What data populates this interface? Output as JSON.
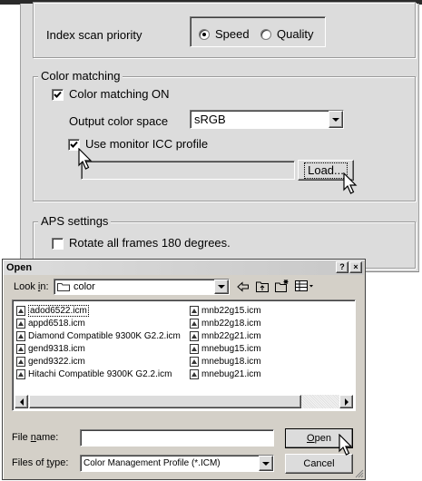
{
  "settings": {
    "index_scan": {
      "label": "Index scan priority",
      "options": [
        {
          "label": "Speed",
          "selected": true
        },
        {
          "label": "Quality",
          "selected": false
        }
      ]
    },
    "color_matching": {
      "title": "Color matching",
      "enable_label": "Color matching ON",
      "enable_checked": true,
      "output_space_label": "Output color space",
      "output_space_value": "sRGB",
      "monitor_icc_label": "Use monitor ICC profile",
      "monitor_icc_checked": true,
      "icc_path": "",
      "load_label": "Load..."
    },
    "aps": {
      "title": "APS settings",
      "rotate_label": "Rotate all frames 180 degrees.",
      "rotate_checked": false
    }
  },
  "dialog": {
    "title": "Open",
    "help_glyph": "?",
    "close_glyph": "×",
    "look_in_label": "Look in:",
    "look_in_value": "color",
    "files_col1": [
      "adod6522.icm",
      "appd6518.icm",
      "Diamond Compatible 9300K G2.2.icm",
      "gend9318.icm",
      "gend9322.icm",
      "Hitachi Compatible 9300K G2.2.icm"
    ],
    "files_col2": [
      "mnb22g15.icm",
      "mnb22g18.icm",
      "mnb22g21.icm",
      "mnebug15.icm",
      "mnebug18.icm",
      "mnebug21.icm"
    ],
    "file_name_label": "File name:",
    "file_name_value": "",
    "file_type_label": "Files of type:",
    "file_type_value": "Color Management Profile (*.ICM)",
    "open_label": "Open",
    "cancel_label": "Cancel"
  },
  "colors": {
    "panel_bg": "#dcdcdc",
    "dialog_bg": "#d4d0c8",
    "focus_dotted": "#000000"
  }
}
